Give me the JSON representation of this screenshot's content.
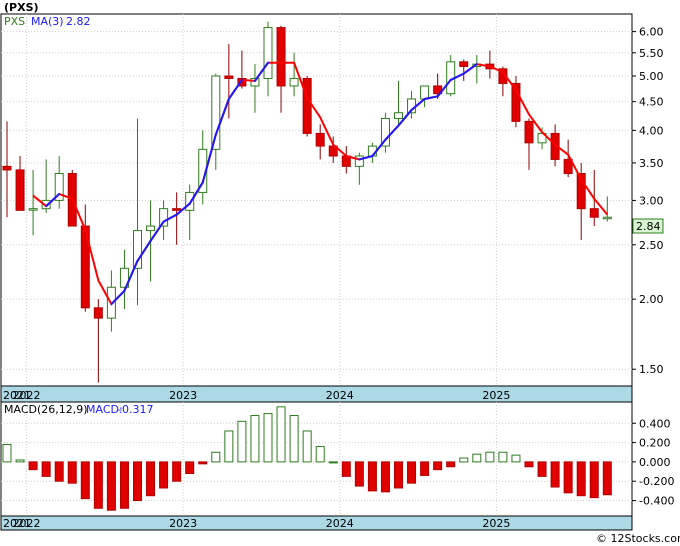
{
  "ticker_title": "(PXS)",
  "watermark": "© 12Stocks.com",
  "colors": {
    "up": "#2e7d1e",
    "down": "#e00000",
    "ma_down": "#ff0000",
    "ma_up": "#1a1aff",
    "strip": "#add8e6",
    "grid": "#cfcfcf",
    "price_tag_bg": "#d7f5d0"
  },
  "chart_data": [
    {
      "type": "candlestick",
      "legend": [
        {
          "name": "PXS",
          "color": "#2e7d1e"
        },
        {
          "name": "MA(3)",
          "value": "2.82",
          "color": "#1a1aff"
        }
      ],
      "price_tag": "2.84",
      "yscale": "log",
      "ylim": [
        1.4,
        6.45
      ],
      "y_ticks": [
        "6.00",
        "5.50",
        "5.00",
        "4.50",
        "4.00",
        "3.50",
        "3.00",
        "2.50",
        "2.00",
        "1.50"
      ],
      "x_ticks": [
        "2021",
        "2022",
        "2023",
        "2024",
        "2025"
      ],
      "months": [
        "2021-11",
        "2021-12",
        "2022-01",
        "2022-02",
        "2022-03",
        "2022-04",
        "2022-05",
        "2022-06",
        "2022-07",
        "2022-08",
        "2022-09",
        "2022-10",
        "2022-11",
        "2022-12",
        "2023-01",
        "2023-02",
        "2023-03",
        "2023-04",
        "2023-05",
        "2023-06",
        "2023-07",
        "2023-08",
        "2023-09",
        "2023-10",
        "2023-11",
        "2023-12",
        "2024-01",
        "2024-02",
        "2024-03",
        "2024-04",
        "2024-05",
        "2024-06",
        "2024-07",
        "2024-08",
        "2024-09",
        "2024-10",
        "2024-11",
        "2024-12",
        "2025-01",
        "2025-02",
        "2025-03",
        "2025-04",
        "2025-05",
        "2025-06",
        "2025-07",
        "2025-08",
        "2025-09"
      ],
      "ohlc": [
        [
          3.45,
          4.15,
          2.8,
          3.4
        ],
        [
          3.4,
          3.6,
          2.9,
          2.88
        ],
        [
          2.9,
          3.4,
          2.6,
          2.9
        ],
        [
          2.9,
          3.55,
          2.85,
          3.0
        ],
        [
          3.0,
          3.6,
          2.9,
          3.35
        ],
        [
          3.35,
          3.4,
          2.7,
          2.7
        ],
        [
          2.7,
          2.95,
          1.9,
          1.93
        ],
        [
          1.93,
          2.0,
          1.42,
          1.85
        ],
        [
          1.85,
          2.25,
          1.75,
          2.1
        ],
        [
          2.1,
          2.45,
          1.92,
          2.27
        ],
        [
          2.27,
          4.2,
          1.95,
          2.65
        ],
        [
          2.65,
          3.0,
          2.15,
          2.7
        ],
        [
          2.7,
          3.0,
          2.55,
          2.9
        ],
        [
          2.9,
          3.1,
          2.5,
          2.88
        ],
        [
          2.88,
          3.2,
          2.55,
          3.1
        ],
        [
          3.1,
          4.0,
          2.95,
          3.7
        ],
        [
          3.7,
          5.05,
          3.4,
          5.0
        ],
        [
          5.0,
          5.7,
          4.2,
          4.95
        ],
        [
          4.95,
          5.55,
          4.75,
          4.8
        ],
        [
          4.8,
          5.25,
          4.3,
          4.95
        ],
        [
          4.95,
          6.25,
          4.6,
          6.1
        ],
        [
          6.1,
          6.15,
          4.3,
          4.8
        ],
        [
          4.8,
          5.5,
          4.6,
          4.95
        ],
        [
          4.95,
          5.0,
          3.9,
          3.95
        ],
        [
          3.95,
          4.1,
          3.55,
          3.75
        ],
        [
          3.75,
          3.9,
          3.5,
          3.6
        ],
        [
          3.6,
          3.75,
          3.35,
          3.45
        ],
        [
          3.45,
          3.65,
          3.2,
          3.6
        ],
        [
          3.6,
          3.8,
          3.5,
          3.75
        ],
        [
          3.75,
          4.3,
          3.65,
          4.2
        ],
        [
          4.2,
          4.9,
          4.1,
          4.3
        ],
        [
          4.3,
          4.7,
          4.2,
          4.55
        ],
        [
          4.55,
          4.8,
          4.4,
          4.8
        ],
        [
          4.8,
          5.05,
          4.55,
          4.65
        ],
        [
          4.65,
          5.45,
          4.6,
          5.3
        ],
        [
          5.3,
          5.35,
          4.9,
          5.2
        ],
        [
          5.2,
          5.45,
          4.85,
          5.25
        ],
        [
          5.25,
          5.55,
          4.95,
          5.15
        ],
        [
          5.15,
          5.2,
          4.6,
          4.85
        ],
        [
          4.85,
          5.0,
          4.05,
          4.15
        ],
        [
          4.15,
          4.2,
          3.4,
          3.8
        ],
        [
          3.8,
          4.05,
          3.7,
          3.95
        ],
        [
          3.95,
          4.1,
          3.45,
          3.55
        ],
        [
          3.55,
          3.85,
          3.3,
          3.35
        ],
        [
          3.35,
          3.5,
          2.55,
          2.9
        ],
        [
          2.9,
          3.4,
          2.7,
          2.8
        ],
        [
          2.8,
          3.05,
          2.75,
          2.8
        ]
      ],
      "ma3": [
        null,
        null,
        3.06,
        2.93,
        3.08,
        3.02,
        2.66,
        2.16,
        1.96,
        2.07,
        2.34,
        2.54,
        2.75,
        2.83,
        2.96,
        3.23,
        3.93,
        4.55,
        4.92,
        4.9,
        5.28,
        5.28,
        5.28,
        4.57,
        4.22,
        3.77,
        3.6,
        3.55,
        3.6,
        3.85,
        4.08,
        4.35,
        4.55,
        4.6,
        4.92,
        5.05,
        5.25,
        5.2,
        5.08,
        4.72,
        4.27,
        3.97,
        3.77,
        3.62,
        3.27,
        3.02,
        2.83
      ]
    },
    {
      "type": "bar",
      "legend": [
        {
          "name": "MACD(26,12,9)",
          "color": "#000000"
        },
        {
          "name": "MACD:",
          "value": "-0.317",
          "color": "#1a1aff"
        }
      ],
      "ylim": [
        -0.56,
        0.62
      ],
      "y_ticks": [
        "0.400",
        "0.200",
        "0.000",
        "-0.200",
        "-0.400"
      ],
      "x_ticks": [
        "2021",
        "2022",
        "2023",
        "2024",
        "2025"
      ],
      "values": [
        0.18,
        0.02,
        -0.08,
        -0.15,
        -0.2,
        -0.22,
        -0.38,
        -0.48,
        -0.5,
        -0.48,
        -0.4,
        -0.35,
        -0.27,
        -0.2,
        -0.12,
        -0.02,
        0.1,
        0.32,
        0.42,
        0.48,
        0.5,
        0.57,
        0.48,
        0.32,
        0.16,
        0.0,
        -0.15,
        -0.25,
        -0.3,
        -0.31,
        -0.27,
        -0.22,
        -0.14,
        -0.08,
        -0.05,
        0.04,
        0.08,
        0.1,
        0.1,
        0.07,
        -0.05,
        -0.15,
        -0.26,
        -0.32,
        -0.35,
        -0.37,
        -0.34
      ]
    }
  ]
}
